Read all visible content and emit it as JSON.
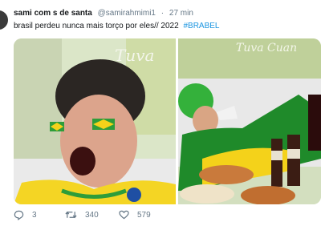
{
  "tweet": {
    "display_name": "sami com s de santa",
    "handle": "@samirahmimi1",
    "separator": "·",
    "time": "27 min",
    "text": "brasil perdeu nunca mais torço por eles// 2022",
    "hashtag": "#BRABEL"
  },
  "media": {
    "left_image_text": "Tuva",
    "right_image_text": "Tuva Cuan"
  },
  "actions": {
    "replies": "3",
    "retweets": "340",
    "likes": "579"
  },
  "colors": {
    "text": "#14171a",
    "muted": "#657786",
    "hashtag": "#1b95e0"
  }
}
